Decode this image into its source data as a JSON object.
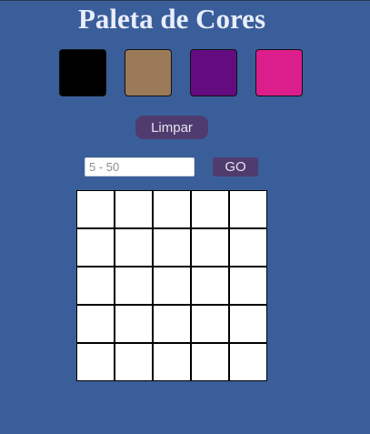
{
  "page": {
    "title": "Paleta de Cores"
  },
  "palette": {
    "colors": [
      {
        "name": "black",
        "hex": "#000000"
      },
      {
        "name": "brown",
        "hex": "#9b7a5a"
      },
      {
        "name": "purple",
        "hex": "#650b80"
      },
      {
        "name": "pink",
        "hex": "#dc1d8c"
      }
    ]
  },
  "controls": {
    "clear_label": "Limpar",
    "size_placeholder": "5 - 50",
    "size_value": "",
    "go_label": "GO"
  },
  "board": {
    "rows": 5,
    "cols": 5,
    "cell_color": "#ffffff",
    "border_color": "#000000"
  },
  "colors": {
    "background": "#3a5e9a",
    "button": "#4f3b6e",
    "title_text": "#e9eefb"
  }
}
